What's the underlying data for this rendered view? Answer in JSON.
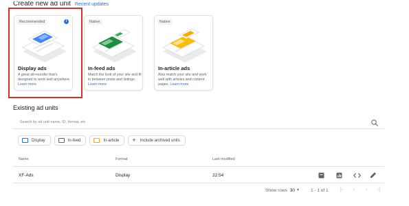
{
  "header": {
    "title": "Create new ad unit",
    "recent_updates": "Recent updates"
  },
  "cards": [
    {
      "badge": "Recommended",
      "info": "i",
      "title": "Display ads",
      "description": "A great all-rounder that's designed to work well anywhere.",
      "learn_more": "Learn more"
    },
    {
      "badge": "Native",
      "title": "In-feed ads",
      "description": "Match the look of your site and fit in between posts and listings.",
      "learn_more": "Learn more"
    },
    {
      "badge": "Native",
      "title": "In-article ads",
      "description": "Also match your site and work well with articles and content pages.",
      "learn_more": "Learn more"
    }
  ],
  "existing": {
    "title": "Existing ad units",
    "search_placeholder": "Search by ad unit name, ID, format, etc",
    "filters": [
      {
        "label": "Display",
        "color": "#1a73e8"
      },
      {
        "label": "In-feed",
        "color": "#1e8e3e"
      },
      {
        "label": "In-article",
        "color": "#f9ab00"
      }
    ],
    "include_archived": "Include archived units",
    "columns": {
      "name": "Name",
      "format": "Format",
      "last_modified": "Last modified"
    },
    "rows": [
      {
        "name": "XF-Ads",
        "format": "Display",
        "last_modified": "22:54"
      }
    ],
    "pagination": {
      "show_rows_label": "Show rows",
      "rows_value": "30",
      "range": "1 - 1 of 1"
    }
  },
  "colors": {
    "accent": "#1a73e8",
    "highlight": "#d93025",
    "green": "#1e8e3e",
    "yellow": "#fbbc04"
  }
}
